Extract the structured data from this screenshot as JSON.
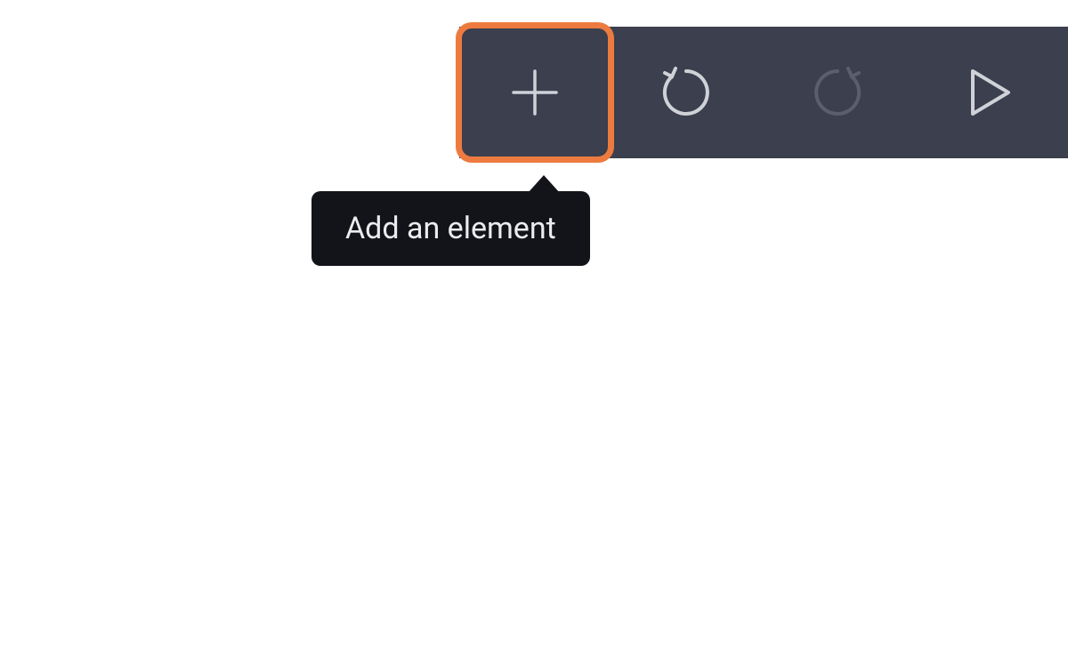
{
  "toolbar": {
    "add_tooltip": "Add an element",
    "icons": {
      "add": "plus-icon",
      "undo": "undo-icon",
      "redo": "redo-icon",
      "play": "play-icon"
    }
  },
  "colors": {
    "toolbar_bg": "#3b3f4e",
    "tooltip_bg": "#121419",
    "highlight": "#ed7b3f",
    "icon_active": "#d0d2d8",
    "icon_dim": "#5a5f6e"
  }
}
